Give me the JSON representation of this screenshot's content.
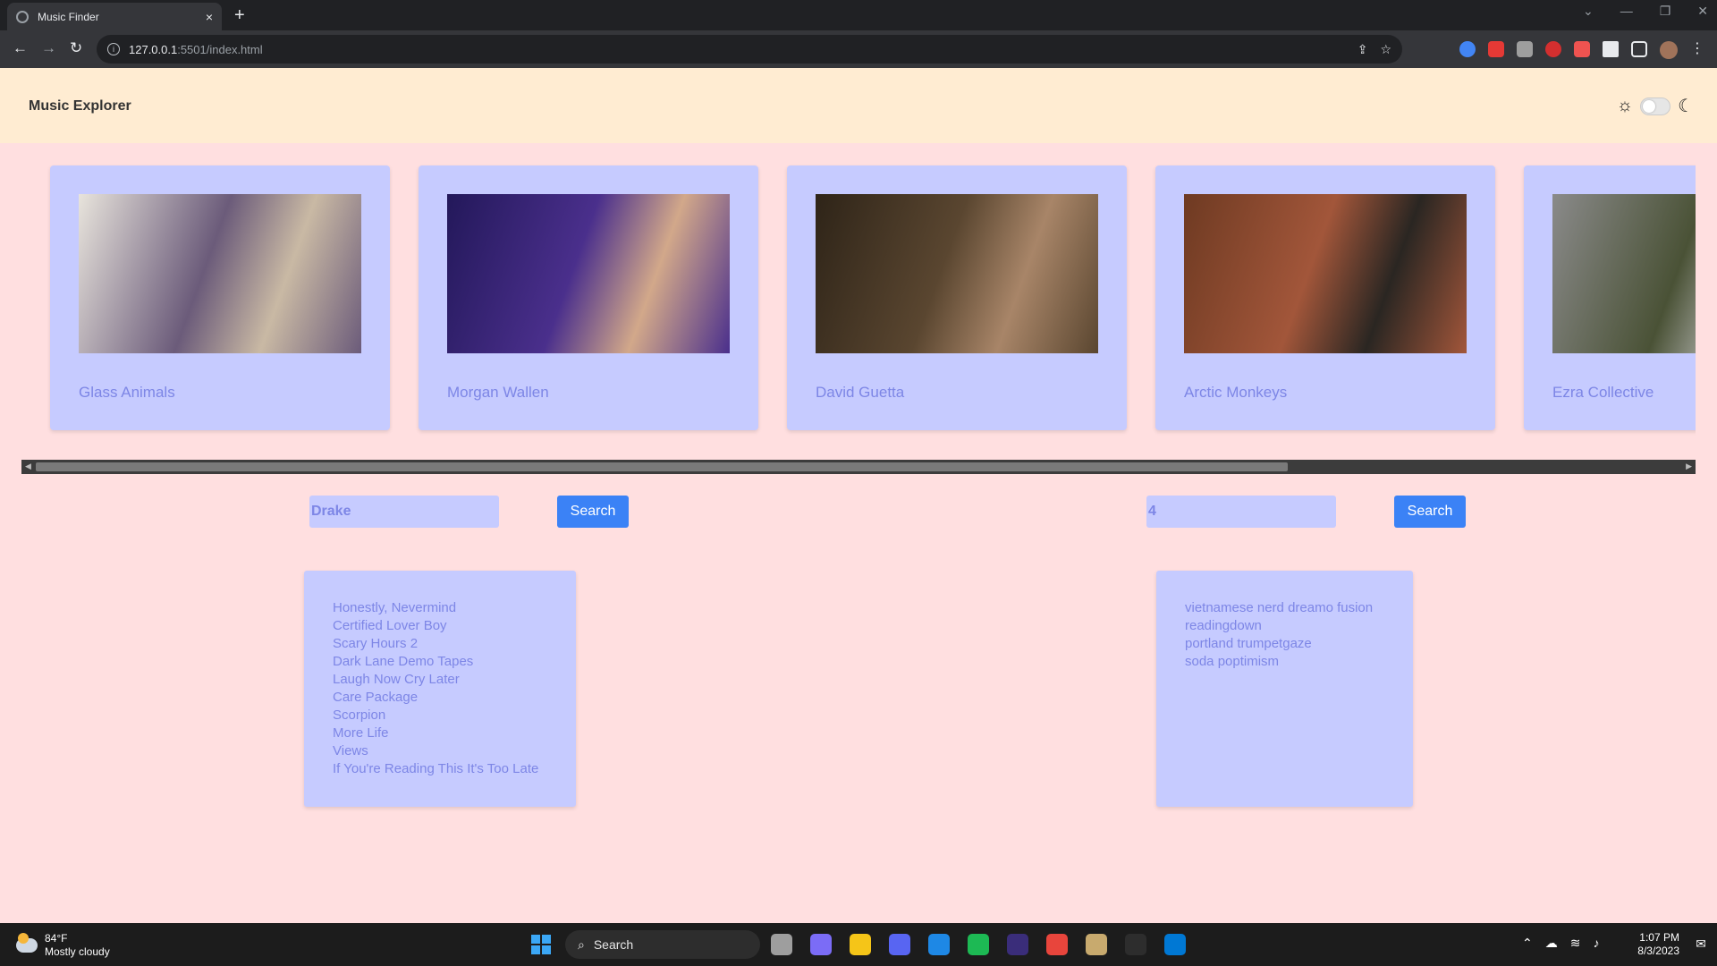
{
  "browser": {
    "tab_title": "Music Finder",
    "tab_close": "×",
    "new_tab": "+",
    "url_host": "127.0.0.1",
    "url_path": ":5501/index.html",
    "window_controls": [
      "⌄",
      "—",
      "❐",
      "✕"
    ]
  },
  "header": {
    "brand": "Music Explorer",
    "theme_toggle": {
      "sun_icon": "☼",
      "moon_icon": "☾",
      "dark_mode": false
    }
  },
  "artists": [
    {
      "name": "Glass Animals",
      "img_colors": [
        "#e8e4dc",
        "#6b5b7a",
        "#c9b9a4"
      ]
    },
    {
      "name": "Morgan Wallen",
      "img_colors": [
        "#23185a",
        "#4a2f8c",
        "#d2a88a"
      ]
    },
    {
      "name": "David Guetta",
      "img_colors": [
        "#2e2418",
        "#5a4630",
        "#a88568"
      ]
    },
    {
      "name": "Arctic Monkeys",
      "img_colors": [
        "#6e3a22",
        "#a2563a",
        "#2a2622"
      ]
    },
    {
      "name": "Ezra Collective",
      "img_colors": [
        "#8a8a8a",
        "#4a5236",
        "#c6c6c6"
      ]
    }
  ],
  "left_search": {
    "value": "Drake",
    "button": "Search",
    "results": [
      "Honestly, Nevermind",
      "Certified Lover Boy",
      "Scary Hours 2",
      "Dark Lane Demo Tapes",
      "Laugh Now Cry Later",
      "Care Package",
      "Scorpion",
      "More Life",
      "Views",
      "If You're Reading This It's Too Late"
    ]
  },
  "right_search": {
    "value": "4",
    "button": "Search",
    "results": [
      "vietnamese nerd dreamo fusion",
      "readingdown",
      "portland trumpetgaze",
      "soda poptimism"
    ]
  },
  "taskbar": {
    "temperature": "84°F",
    "weather": "Mostly cloudy",
    "search_label": "Search",
    "time": "1:07 PM",
    "date": "8/3/2023",
    "app_colors": [
      "#9e9e9e",
      "#7b6cf6",
      "#f5c518",
      "#5865f2",
      "#1e88e5",
      "#1db954",
      "#3a2d7a",
      "#e8453c",
      "#c8aa6e",
      "#2d2d2d",
      "#0078d4"
    ]
  },
  "colors": {
    "page_bg": "#ffdfe0",
    "header_bg": "#ffecd2",
    "card_bg": "#c6cbff",
    "card_text": "#7d86e6",
    "button_bg": "#3b82f6"
  }
}
